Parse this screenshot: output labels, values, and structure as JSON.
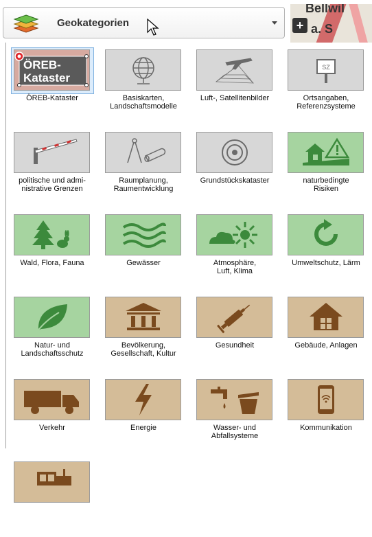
{
  "dropdown": {
    "label": "Geokategorien",
    "icon": "layers-icon"
  },
  "map": {
    "snippet_line1": "Bellwil",
    "snippet_line2": "a. S",
    "zoom_label": "+"
  },
  "categories": [
    {
      "label": "ÖREB-Kataster",
      "icon": "oereb-icon",
      "style": "oereb",
      "selected": true,
      "tile_text": "ÖREB-\nKataster"
    },
    {
      "label": "Basiskarten,\nLandschaftsmodelle",
      "icon": "globe-icon",
      "style": "gray"
    },
    {
      "label": "Luft-, Satellitenbilder",
      "icon": "airplane-icon",
      "style": "gray"
    },
    {
      "label": "Ortsangaben,\nReferenzsysteme",
      "icon": "sign-icon",
      "style": "gray",
      "sign_text": "SZ"
    },
    {
      "label": "politische und admi-\nnistrative Grenzen",
      "icon": "barrier-icon",
      "style": "gray"
    },
    {
      "label": "Raumplanung,\nRaumentwicklung",
      "icon": "compass-icon",
      "style": "gray"
    },
    {
      "label": "Grundstückskataster",
      "icon": "survey-point-icon",
      "style": "gray"
    },
    {
      "label": "naturbedingte\nRisiken",
      "icon": "hazard-house-icon",
      "style": "green"
    },
    {
      "label": "Wald, Flora, Fauna",
      "icon": "tree-rabbit-icon",
      "style": "green"
    },
    {
      "label": "Gewässer",
      "icon": "water-waves-icon",
      "style": "green"
    },
    {
      "label": "Atmosphäre,\nLuft, Klima",
      "icon": "cloud-sun-icon",
      "style": "green"
    },
    {
      "label": "Umweltschutz, Lärm",
      "icon": "recycle-arrow-icon",
      "style": "green"
    },
    {
      "label": "Natur- und\nLandschaftsschutz",
      "icon": "leaf-icon",
      "style": "green"
    },
    {
      "label": "Bevölkerung,\nGesellschaft, Kultur",
      "icon": "museum-icon",
      "style": "tan"
    },
    {
      "label": "Gesundheit",
      "icon": "syringe-icon",
      "style": "tan"
    },
    {
      "label": "Gebäude, Anlagen",
      "icon": "building-icon",
      "style": "tan"
    },
    {
      "label": "Verkehr",
      "icon": "truck-icon",
      "style": "tan"
    },
    {
      "label": "Energie",
      "icon": "lightning-icon",
      "style": "tan"
    },
    {
      "label": "Wasser- und\nAbfallsysteme",
      "icon": "faucet-bin-icon",
      "style": "tan"
    },
    {
      "label": "Kommunikation",
      "icon": "smartphone-icon",
      "style": "tan"
    },
    {
      "label": "",
      "icon": "tractor-icon",
      "style": "tan"
    }
  ],
  "colors": {
    "gray_tile": "#d7d7d7",
    "green_tile": "#a6d4a0",
    "tan_tile": "#d4bc98",
    "oereb_tile": "#d7aaa0",
    "green_icon": "#3c8a3c",
    "tan_icon": "#7a4a1e",
    "gray_icon": "#6a6a6a"
  }
}
